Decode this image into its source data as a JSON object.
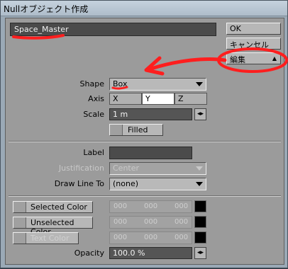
{
  "window": {
    "title": "Nullオブジェクト作成"
  },
  "object_name": "Space_Master",
  "buttons": {
    "ok": "OK",
    "cancel": "キャンセル",
    "edit": "編集",
    "edit_arrow": "▲"
  },
  "shape": {
    "label": "Shape",
    "value": "Box"
  },
  "axis": {
    "label": "Axis",
    "options": [
      "X",
      "Y",
      "Z"
    ],
    "selected": "Y"
  },
  "scale": {
    "label": "Scale",
    "value": "1 m",
    "spinner": "◂▸"
  },
  "filled": {
    "label": "Filled"
  },
  "label_field": {
    "label": "Label",
    "value": ""
  },
  "justification": {
    "label": "Justification",
    "value": "Center"
  },
  "draw_line_to": {
    "label": "Draw Line To",
    "value": "(none)"
  },
  "colors": {
    "selected": {
      "label": "Selected Color",
      "r": "000",
      "g": "000",
      "b": "000"
    },
    "unselected": {
      "label": "Unselected Color",
      "r": "000",
      "g": "000",
      "b": "000"
    },
    "text": {
      "label": "Text Color",
      "r": "000",
      "g": "000",
      "b": "000"
    }
  },
  "opacity": {
    "label": "Opacity",
    "value": "100.0 %",
    "spinner": "◂▸"
  },
  "annotation_color": "#ff1e1e"
}
